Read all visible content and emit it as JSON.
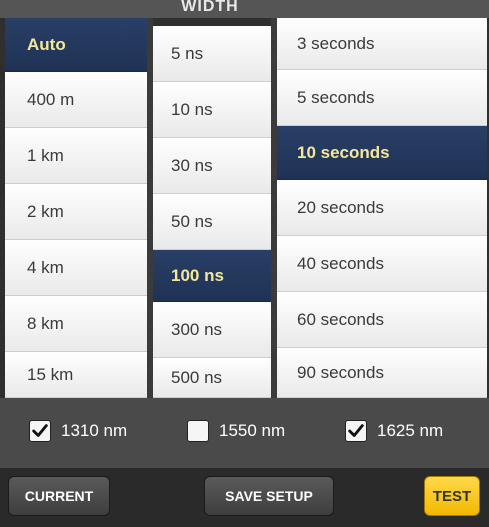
{
  "header": {
    "title": "WIDTH"
  },
  "columns": {
    "range": {
      "items": [
        "Auto",
        "400 m",
        "1 km",
        "2 km",
        "4 km",
        "8 km",
        "15 km"
      ],
      "selected_index": 0
    },
    "pulse_width": {
      "items": [
        "5 ns",
        "10 ns",
        "30 ns",
        "50 ns",
        "100 ns",
        "300 ns",
        "500 ns"
      ],
      "selected_index": 4
    },
    "duration": {
      "items": [
        "3 seconds",
        "5 seconds",
        "10 seconds",
        "20 seconds",
        "40 seconds",
        "60 seconds",
        "90 seconds"
      ],
      "selected_index": 2
    }
  },
  "wavelengths": [
    {
      "label": "1310 nm",
      "checked": true
    },
    {
      "label": "1550 nm",
      "checked": false
    },
    {
      "label": "1625 nm",
      "checked": true
    }
  ],
  "footer": {
    "current_label": "CURRENT",
    "save_setup_label": "SAVE SETUP",
    "test_label": "TEST"
  },
  "colors": {
    "selected_bg": "#23375d",
    "selected_text": "#f3e89a",
    "test_button": "#f7c520"
  }
}
